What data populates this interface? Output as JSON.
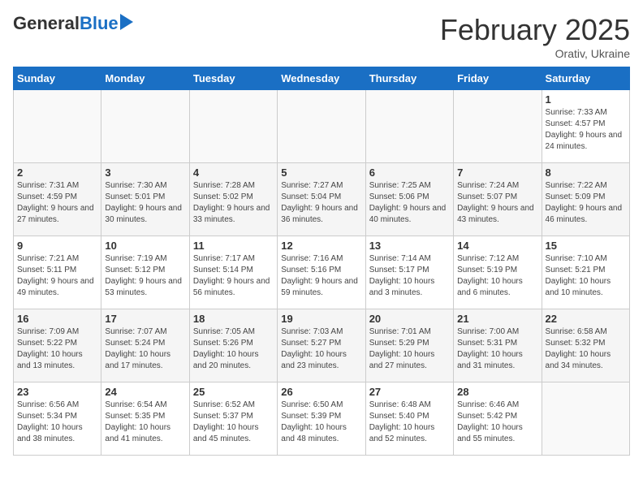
{
  "header": {
    "logo_general": "General",
    "logo_blue": "Blue",
    "month": "February 2025",
    "location": "Orativ, Ukraine"
  },
  "days_of_week": [
    "Sunday",
    "Monday",
    "Tuesday",
    "Wednesday",
    "Thursday",
    "Friday",
    "Saturday"
  ],
  "weeks": [
    [
      {
        "day": "",
        "info": ""
      },
      {
        "day": "",
        "info": ""
      },
      {
        "day": "",
        "info": ""
      },
      {
        "day": "",
        "info": ""
      },
      {
        "day": "",
        "info": ""
      },
      {
        "day": "",
        "info": ""
      },
      {
        "day": "1",
        "info": "Sunrise: 7:33 AM\nSunset: 4:57 PM\nDaylight: 9 hours and 24 minutes."
      }
    ],
    [
      {
        "day": "2",
        "info": "Sunrise: 7:31 AM\nSunset: 4:59 PM\nDaylight: 9 hours and 27 minutes."
      },
      {
        "day": "3",
        "info": "Sunrise: 7:30 AM\nSunset: 5:01 PM\nDaylight: 9 hours and 30 minutes."
      },
      {
        "day": "4",
        "info": "Sunrise: 7:28 AM\nSunset: 5:02 PM\nDaylight: 9 hours and 33 minutes."
      },
      {
        "day": "5",
        "info": "Sunrise: 7:27 AM\nSunset: 5:04 PM\nDaylight: 9 hours and 36 minutes."
      },
      {
        "day": "6",
        "info": "Sunrise: 7:25 AM\nSunset: 5:06 PM\nDaylight: 9 hours and 40 minutes."
      },
      {
        "day": "7",
        "info": "Sunrise: 7:24 AM\nSunset: 5:07 PM\nDaylight: 9 hours and 43 minutes."
      },
      {
        "day": "8",
        "info": "Sunrise: 7:22 AM\nSunset: 5:09 PM\nDaylight: 9 hours and 46 minutes."
      }
    ],
    [
      {
        "day": "9",
        "info": "Sunrise: 7:21 AM\nSunset: 5:11 PM\nDaylight: 9 hours and 49 minutes."
      },
      {
        "day": "10",
        "info": "Sunrise: 7:19 AM\nSunset: 5:12 PM\nDaylight: 9 hours and 53 minutes."
      },
      {
        "day": "11",
        "info": "Sunrise: 7:17 AM\nSunset: 5:14 PM\nDaylight: 9 hours and 56 minutes."
      },
      {
        "day": "12",
        "info": "Sunrise: 7:16 AM\nSunset: 5:16 PM\nDaylight: 9 hours and 59 minutes."
      },
      {
        "day": "13",
        "info": "Sunrise: 7:14 AM\nSunset: 5:17 PM\nDaylight: 10 hours and 3 minutes."
      },
      {
        "day": "14",
        "info": "Sunrise: 7:12 AM\nSunset: 5:19 PM\nDaylight: 10 hours and 6 minutes."
      },
      {
        "day": "15",
        "info": "Sunrise: 7:10 AM\nSunset: 5:21 PM\nDaylight: 10 hours and 10 minutes."
      }
    ],
    [
      {
        "day": "16",
        "info": "Sunrise: 7:09 AM\nSunset: 5:22 PM\nDaylight: 10 hours and 13 minutes."
      },
      {
        "day": "17",
        "info": "Sunrise: 7:07 AM\nSunset: 5:24 PM\nDaylight: 10 hours and 17 minutes."
      },
      {
        "day": "18",
        "info": "Sunrise: 7:05 AM\nSunset: 5:26 PM\nDaylight: 10 hours and 20 minutes."
      },
      {
        "day": "19",
        "info": "Sunrise: 7:03 AM\nSunset: 5:27 PM\nDaylight: 10 hours and 23 minutes."
      },
      {
        "day": "20",
        "info": "Sunrise: 7:01 AM\nSunset: 5:29 PM\nDaylight: 10 hours and 27 minutes."
      },
      {
        "day": "21",
        "info": "Sunrise: 7:00 AM\nSunset: 5:31 PM\nDaylight: 10 hours and 31 minutes."
      },
      {
        "day": "22",
        "info": "Sunrise: 6:58 AM\nSunset: 5:32 PM\nDaylight: 10 hours and 34 minutes."
      }
    ],
    [
      {
        "day": "23",
        "info": "Sunrise: 6:56 AM\nSunset: 5:34 PM\nDaylight: 10 hours and 38 minutes."
      },
      {
        "day": "24",
        "info": "Sunrise: 6:54 AM\nSunset: 5:35 PM\nDaylight: 10 hours and 41 minutes."
      },
      {
        "day": "25",
        "info": "Sunrise: 6:52 AM\nSunset: 5:37 PM\nDaylight: 10 hours and 45 minutes."
      },
      {
        "day": "26",
        "info": "Sunrise: 6:50 AM\nSunset: 5:39 PM\nDaylight: 10 hours and 48 minutes."
      },
      {
        "day": "27",
        "info": "Sunrise: 6:48 AM\nSunset: 5:40 PM\nDaylight: 10 hours and 52 minutes."
      },
      {
        "day": "28",
        "info": "Sunrise: 6:46 AM\nSunset: 5:42 PM\nDaylight: 10 hours and 55 minutes."
      },
      {
        "day": "",
        "info": ""
      }
    ]
  ]
}
